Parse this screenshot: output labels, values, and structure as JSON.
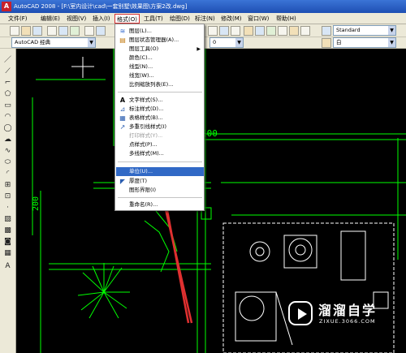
{
  "window": {
    "app_icon": "A",
    "title": "AutoCAD 2008 - [F:\\室内设计\\cad\\一套别墅\\效果图\\方案2改.dwg]"
  },
  "menubar": {
    "items": [
      {
        "label": "文件(F)"
      },
      {
        "label": "编辑(E)"
      },
      {
        "label": "视图(V)"
      },
      {
        "label": "插入(I)"
      },
      {
        "label": "格式(O)"
      },
      {
        "label": "工具(T)"
      },
      {
        "label": "绘图(D)"
      },
      {
        "label": "标注(N)"
      },
      {
        "label": "修改(M)"
      },
      {
        "label": "窗口(W)"
      },
      {
        "label": "帮助(H)"
      }
    ],
    "active": "格式(O)"
  },
  "toolbar": {
    "workspace_select": "AutoCAD 经典",
    "text_style_select": "Standard",
    "layer_color_select": "白",
    "layer_value": "0"
  },
  "format_menu": {
    "items": [
      {
        "label": "图层(L)...",
        "icon": "layers-icon",
        "glyph": "≋",
        "disabled": false
      },
      {
        "label": "图层状态管理器(A)...",
        "icon": "layer-state-icon",
        "glyph": "▤",
        "disabled": false
      },
      {
        "label": "图层工具(O)",
        "icon": "",
        "glyph": "",
        "disabled": false,
        "submenu": true
      },
      {
        "label": "颜色(C)...",
        "icon": "",
        "glyph": "",
        "disabled": false
      },
      {
        "label": "线型(N)...",
        "icon": "",
        "glyph": "",
        "disabled": false
      },
      {
        "label": "线宽(W)...",
        "icon": "",
        "glyph": "",
        "disabled": false
      },
      {
        "label": "比例缩放列表(E)...",
        "icon": "",
        "glyph": "",
        "disabled": false
      },
      {
        "label": "文字样式(S)...",
        "icon": "text-style-icon",
        "glyph": "A",
        "disabled": false
      },
      {
        "label": "标注样式(D)...",
        "icon": "dimension-style-icon",
        "glyph": "⊿",
        "disabled": false
      },
      {
        "label": "表格样式(B)...",
        "icon": "table-style-icon",
        "glyph": "▦",
        "disabled": false
      },
      {
        "label": "多重引线样式(I)",
        "icon": "multileader-style-icon",
        "glyph": "↗",
        "disabled": false
      },
      {
        "label": "打印样式(Y)...",
        "icon": "",
        "glyph": "",
        "disabled": true
      },
      {
        "label": "点样式(P)...",
        "icon": "",
        "glyph": "",
        "disabled": false
      },
      {
        "label": "多线样式(M)...",
        "icon": "",
        "glyph": "",
        "disabled": false
      },
      {
        "label": "单位(U)...",
        "icon": "",
        "glyph": "",
        "disabled": false,
        "highlighted": true
      },
      {
        "label": "厚度(T)",
        "icon": "thickness-icon",
        "glyph": "◤",
        "disabled": false
      },
      {
        "label": "图形界限(I)",
        "icon": "",
        "glyph": "",
        "disabled": false
      },
      {
        "label": "重命名(R)...",
        "icon": "",
        "glyph": "",
        "disabled": false
      }
    ]
  },
  "drawing": {
    "dimension_1": "200",
    "dimension_2": "200",
    "colors": {
      "lines": "#00ff00",
      "plant": "#00ff00",
      "furniture": "#ffffff",
      "annotation_arrow": "#e03030"
    }
  },
  "watermark": {
    "brand": "溜溜自学",
    "site": "ZIXUE.3066.COM"
  }
}
